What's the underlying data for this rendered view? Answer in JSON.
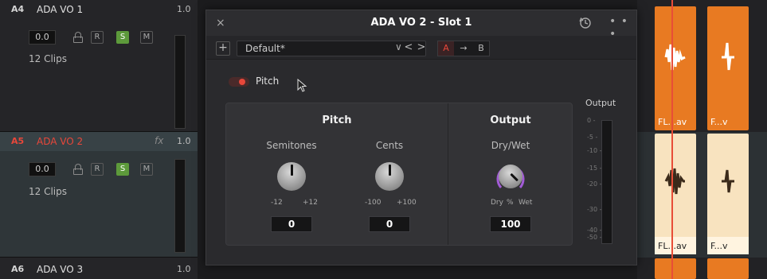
{
  "tracks": [
    {
      "id": "A4",
      "name": "ADA VO 1",
      "volume": "1.0",
      "level": "0.0",
      "clips": "12 Clips",
      "r": "R",
      "s": "S",
      "m": "M"
    },
    {
      "id": "A5",
      "name": "ADA VO 2",
      "volume": "1.0",
      "fx": "fx",
      "level": "0.0",
      "clips": "12 Clips",
      "r": "R",
      "s": "S",
      "m": "M"
    },
    {
      "id": "A6",
      "name": "ADA VO 3",
      "volume": "1.0"
    }
  ],
  "plugin": {
    "title": "ADA VO 2 - Slot 1",
    "close": "×",
    "more": "• • •",
    "add": "+",
    "preset": "Default*",
    "preset_chevron": "∨",
    "prev": "<",
    "next": ">",
    "ab": {
      "a": "A",
      "arrow": "→",
      "b": "B"
    },
    "toggle_label": "Pitch",
    "section_pitch": "Pitch",
    "section_output": "Output",
    "semitones": {
      "label": "Semitones",
      "min": "-12",
      "max": "+12",
      "value": "0"
    },
    "cents": {
      "label": "Cents",
      "min": "-100",
      "max": "+100",
      "value": "0"
    },
    "drywet": {
      "label": "Dry/Wet",
      "min": "Dry",
      "mid": "%",
      "max": "Wet",
      "value": "100"
    },
    "output_meter": {
      "label": "Output",
      "ticks": [
        "0 -",
        "-5 -",
        "-10 -",
        "-15 -",
        "-20 -",
        "-30 -",
        "-40 -",
        "-50 -"
      ]
    }
  },
  "timeline": {
    "clips_top": [
      "FL...av",
      "F...v"
    ],
    "clips_mid": [
      "FL...av",
      "F...v"
    ]
  },
  "colors": {
    "clip_orange": "#e87a22",
    "clip_cream": "#f8e3bf",
    "playhead": "#e84d37",
    "solo_green": "#5d9a3b",
    "accent_red": "#e8473a",
    "knob_ring": "#a25bd6"
  }
}
